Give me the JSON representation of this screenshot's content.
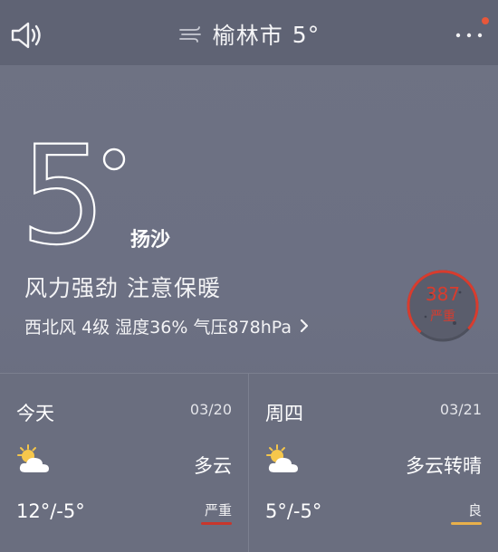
{
  "header": {
    "city": "榆林市",
    "temp": "5°",
    "icons": {
      "sound": "speaker-icon",
      "weather": "wind-icon",
      "menu": "more-icon"
    }
  },
  "current": {
    "temp_number": "5",
    "condition": "扬沙",
    "tip": "风力强劲 注意保暖",
    "details": "西北风 4级 湿度36% 气压878hPa"
  },
  "aqi": {
    "value": "387",
    "level": "严重",
    "color": "#d83c2e"
  },
  "forecast": [
    {
      "day": "今天",
      "date": "03/20",
      "condition": "多云",
      "temp": "12°/-5°",
      "aqi_level": "严重",
      "aqi_color": "#c8362c",
      "icon": "partly-cloudy-icon"
    },
    {
      "day": "周四",
      "date": "03/21",
      "condition": "多云转晴",
      "temp": "5°/-5°",
      "aqi_level": "良",
      "aqi_color": "#e9b04a",
      "icon": "partly-cloudy-icon"
    }
  ]
}
